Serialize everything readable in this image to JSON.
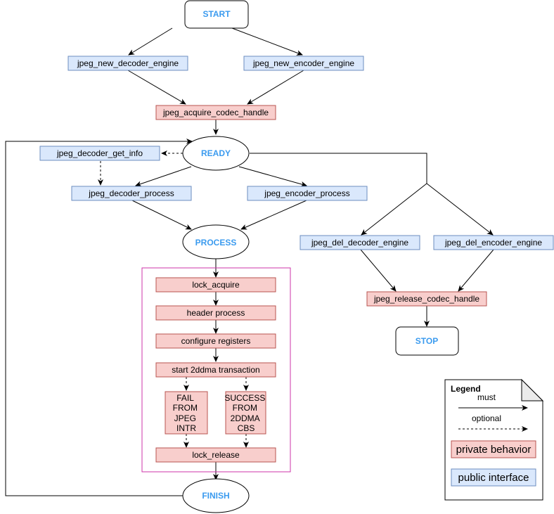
{
  "diagram": {
    "states": {
      "start": "START",
      "ready": "READY",
      "process": "PROCESS",
      "finish": "FINISH",
      "stop": "STOP"
    },
    "public_nodes": {
      "new_decoder": "jpeg_new_decoder_engine",
      "new_encoder": "jpeg_new_encoder_engine",
      "decoder_get_info": "jpeg_decoder_get_info",
      "decoder_process": "jpeg_decoder_process",
      "encoder_process": "jpeg_encoder_process",
      "del_decoder": "jpeg_del_decoder_engine",
      "del_encoder": "jpeg_del_encoder_engine"
    },
    "private_nodes": {
      "acquire_codec": "jpeg_acquire_codec_handle",
      "release_codec": "jpeg_release_codec_handle",
      "lock_acquire": "lock_acquire",
      "header_process": "header process",
      "configure_registers": "configure registers",
      "start_2ddma": "start 2ddma transaction",
      "fail_lines": [
        "FAIL",
        "FROM",
        "JPEG",
        "INTR"
      ],
      "success_lines": [
        "SUCCESS",
        "FROM",
        "2DDMA",
        "CBS"
      ],
      "lock_release": "lock_release"
    },
    "colors": {
      "public_fill": "#dae8fc",
      "public_stroke": "#6c8ebf",
      "private_fill": "#f8cecc",
      "private_stroke": "#b85450",
      "state_text": "#3b9bef",
      "group_border": "#cc33aa"
    }
  },
  "legend": {
    "title": "Legend",
    "must": "must",
    "optional": "optional",
    "private": "private behavior",
    "public": "public interface"
  }
}
